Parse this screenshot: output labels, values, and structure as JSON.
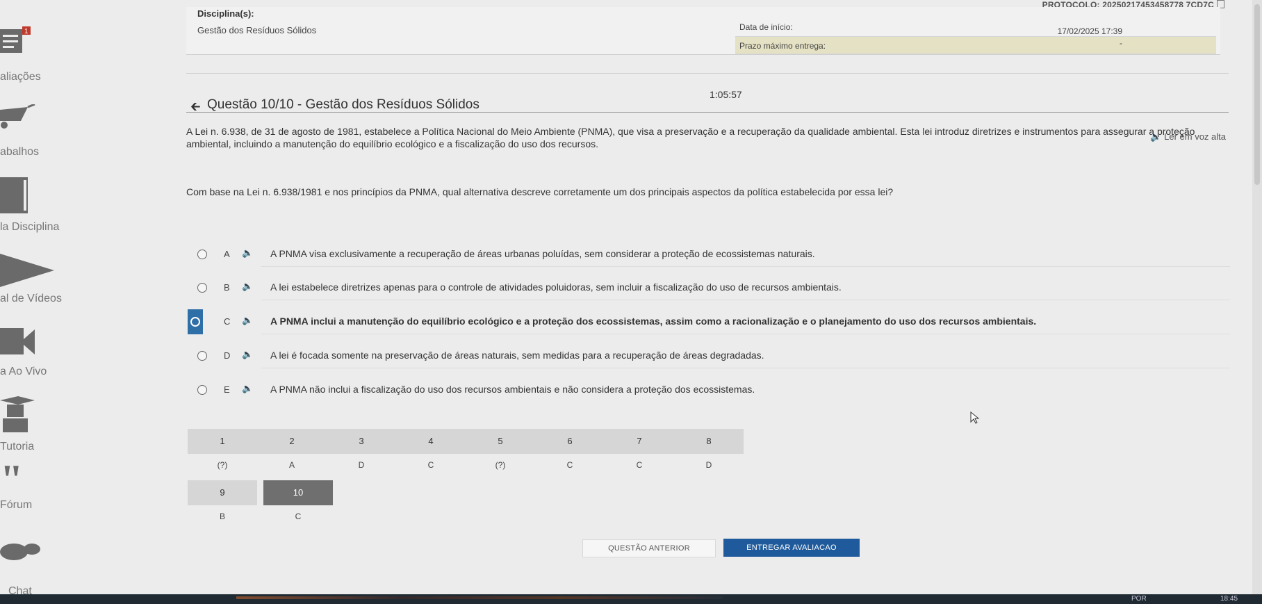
{
  "protocol": "PROTOCOLO: 20250217453458778 7CD7C",
  "header": {
    "discipline_label": "Disciplina(s):",
    "discipline_value": "Gestão dos Resíduos Sólidos",
    "start_label": "Data de início:",
    "start_value": "17/02/2025 17:39",
    "due_label": "Prazo máximo entrega:",
    "due_value": "-"
  },
  "timer": "1:05:57",
  "question": {
    "title": "Questão 10/10 - Gestão dos Resíduos Sólidos",
    "listen_label": "Ler em voz alta",
    "text": "A Lei n. 6.938, de 31 de agosto de 1981, estabelece a Política Nacional do Meio Ambiente (PNMA), que visa a preservação e a recuperação da qualidade ambiental. Esta lei introduz diretrizes e instrumentos para assegurar a proteção ambiental, incluindo a manutenção do equilíbrio ecológico e a fiscalização do uso dos recursos.",
    "prompt": "Com base na Lei n. 6.938/1981 e nos princípios da PNMA, qual alternativa descreve corretamente um dos principais aspectos da política estabelecida por essa lei?"
  },
  "alternatives": [
    {
      "letter": "A",
      "text": "A PNMA visa exclusivamente a recuperação de áreas urbanas poluídas, sem considerar a proteção de ecossistemas naturais."
    },
    {
      "letter": "B",
      "text": "A lei estabelece diretrizes apenas para o controle de atividades poluidoras, sem incluir a fiscalização do uso de recursos ambientais."
    },
    {
      "letter": "C",
      "text": "A PNMA inclui a manutenção do equilíbrio ecológico e a proteção dos ecossistemas, assim como a racionalização e o planejamento do uso dos recursos ambientais."
    },
    {
      "letter": "D",
      "text": "A lei é focada somente na preservação de áreas naturais, sem medidas para a recuperação de áreas degradadas."
    },
    {
      "letter": "E",
      "text": "A PNMA não inclui a fiscalização do uso dos recursos ambientais e não considera a proteção dos ecossistemas."
    }
  ],
  "selected_alternative": "C",
  "nav_grid": {
    "numbers": [
      "1",
      "2",
      "3",
      "4",
      "5",
      "6",
      "7",
      "8",
      "9",
      "10"
    ],
    "answers": [
      "(?)",
      "A",
      "D",
      "C",
      "(?)",
      "C",
      "C",
      "D",
      "B",
      "C"
    ],
    "current": "10"
  },
  "buttons": {
    "previous": "QUESTÃO ANTERIOR",
    "submit": "ENTREGAR AVALIACAO"
  },
  "sidebar": [
    {
      "label": "aliações",
      "icon": "clipboard-icon"
    },
    {
      "label": "abalhos",
      "icon": "wheelbarrow-icon"
    },
    {
      "label": "la Disciplina",
      "icon": "book-icon"
    },
    {
      "label": "al de Vídeos",
      "icon": "play-icon"
    },
    {
      "label": "a Ao Vivo",
      "icon": "camera-icon"
    },
    {
      "label": "Tutoria",
      "icon": "tutor-icon"
    },
    {
      "label": "Fórum",
      "icon": "quote-icon"
    },
    {
      "label": "Chat",
      "icon": "chat-icon"
    }
  ],
  "taskbar": {
    "lang": "POR",
    "time": "18:45"
  },
  "colors": {
    "selected": "#2f6fa8",
    "submit": "#1f5b9c",
    "active_cell": "#6f6f6f"
  }
}
